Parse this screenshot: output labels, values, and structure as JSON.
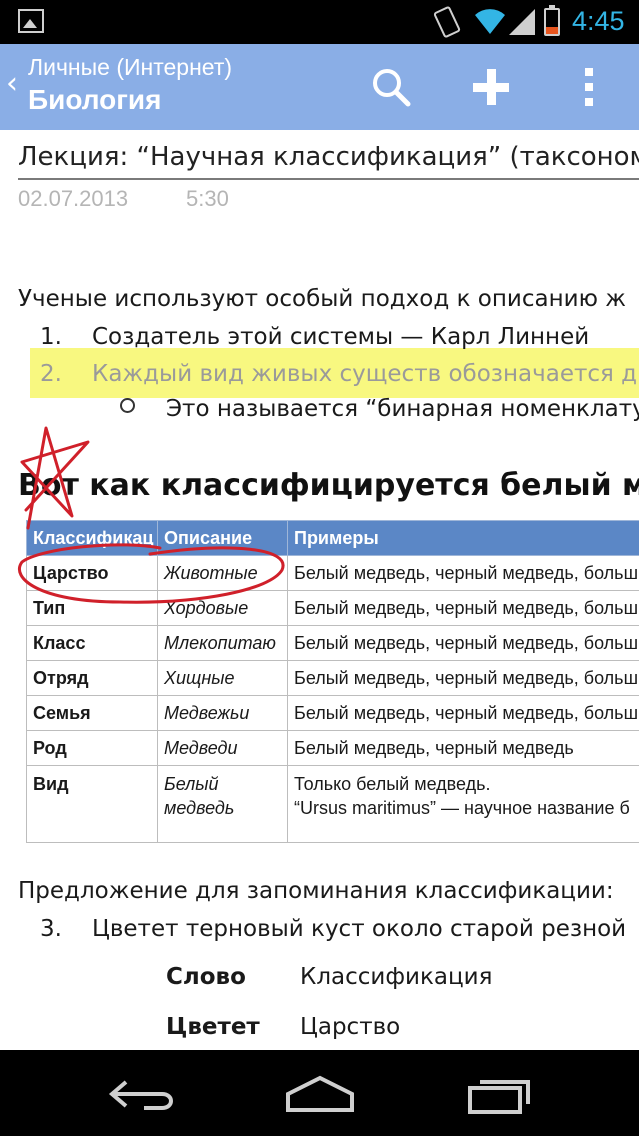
{
  "status_bar": {
    "time": "4:45",
    "icons": [
      "gallery-icon",
      "vibrate-icon",
      "wifi-icon",
      "signal-icon",
      "battery-icon"
    ],
    "clock_color": "#33b5e5"
  },
  "action_bar": {
    "back_glyph": "‹",
    "subtitle": "Личные (Интернет)",
    "title": "Биология",
    "actions": [
      "search-icon",
      "add-icon",
      "overflow-menu-icon"
    ],
    "color": "#8aaee6"
  },
  "note": {
    "title": "Лекция: “Научная классификация” (таксоном",
    "date": "02.07.2013",
    "time": "5:30",
    "intro": "Ученые используют особый подход к описанию ж",
    "list": [
      {
        "num": "1.",
        "text": "Создатель этой системы — Карл Линней"
      },
      {
        "num": "2.",
        "text": "Каждый вид живых существ обозначается д"
      }
    ],
    "sub_bullet": "Это называется “бинарная номенклату",
    "heading": "Вот как классифицируется белый мед",
    "table": {
      "headers": [
        "Классификац",
        "Описание",
        "Примеры"
      ],
      "rows": [
        {
          "rank": "Царство",
          "desc": "Животные",
          "examples": "Белый медведь, черный медведь, больш"
        },
        {
          "rank": "Тип",
          "desc": "Хордовые",
          "examples": "Белый медведь, черный медведь, больш"
        },
        {
          "rank": "Класс",
          "desc": "Млекопитаю",
          "examples": "Белый медведь, черный медведь, больш"
        },
        {
          "rank": "Отряд",
          "desc": "Хищные",
          "examples": "Белый медведь, черный медведь, больш"
        },
        {
          "rank": "Семья",
          "desc": "Медвежьи",
          "examples": "Белый медведь, черный медведь, больш"
        },
        {
          "rank": "Род",
          "desc": "Медведи",
          "examples": "Белый медведь, черный медведь"
        },
        {
          "rank": "Вид",
          "desc": "Белый медведь",
          "examples_line1": "Только белый медведь.",
          "examples_line2": "“Ursus maritimus” — научное название б"
        }
      ]
    },
    "mnemonic_intro": "Предложение для запоминания классификации:",
    "mnemonic_item": {
      "num": "3.",
      "text": "Цветет терновый куст около старой резной"
    },
    "mnemonic_table": [
      {
        "word": "Слово",
        "meaning": "Классификация"
      },
      {
        "word": "Цветет",
        "meaning": "Царство"
      }
    ],
    "highlight_color": "#f7f76a",
    "ink_color": "#d0202a"
  },
  "nav_bar": {
    "buttons": [
      "back-nav-icon",
      "home-nav-icon",
      "recent-apps-icon"
    ]
  }
}
